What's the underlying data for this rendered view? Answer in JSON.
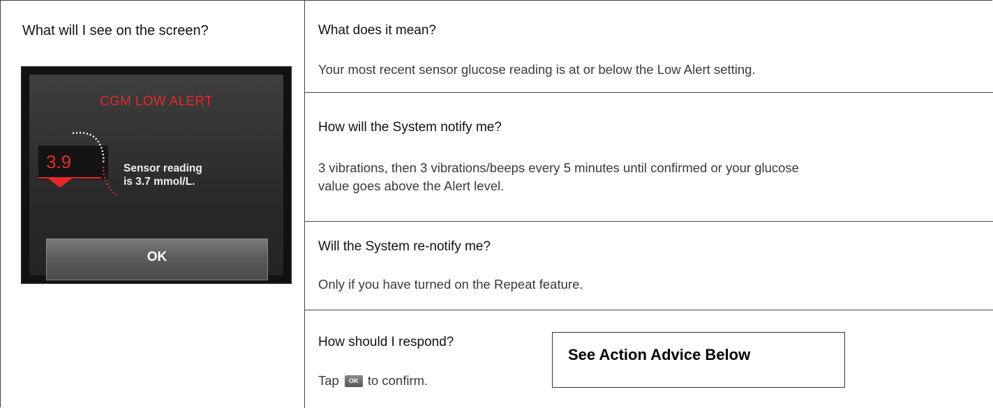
{
  "left": {
    "heading": "What will I see on the screen?",
    "device": {
      "title": "CGM LOW ALERT",
      "reading_value": "3.9",
      "sensor_line1": "Sensor reading",
      "sensor_line2": "is 3.7 mmol/L.",
      "ok_label": "OK",
      "alert_color": "#e8282a"
    }
  },
  "rows": [
    {
      "question": "What does it mean?",
      "answer": "Your most recent sensor glucose reading is at or below the Low Alert setting."
    },
    {
      "question": "How will the System notify me?",
      "answer_line1": "3 vibrations, then 3 vibrations/beeps every 5 minutes until confirmed or your glucose",
      "answer_line2": "value goes above the Alert level."
    },
    {
      "question": "Will the System re-notify me?",
      "answer": "Only if you have turned on the Repeat feature."
    },
    {
      "question": "How should I respond?",
      "tap_prefix": "Tap",
      "mini_ok": "OK",
      "tap_suffix": "to confirm."
    }
  ],
  "advice": "See Action Advice Below"
}
